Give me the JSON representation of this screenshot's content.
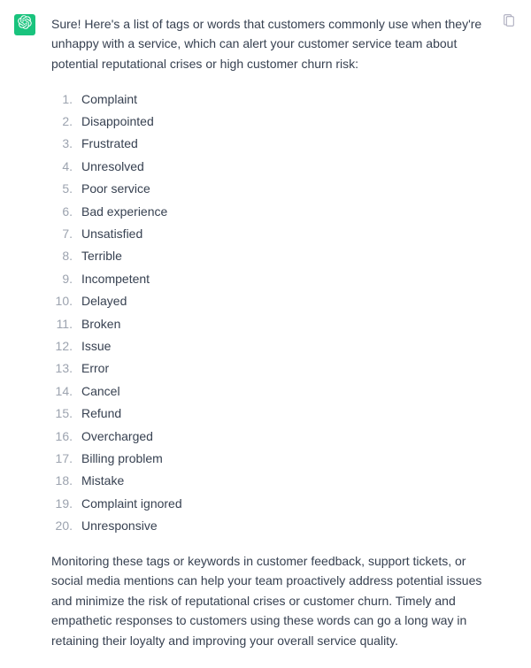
{
  "assistant": {
    "avatar_color": "#19c37d",
    "intro": "Sure! Here's a list of tags or words that customers commonly use when they're unhappy with a service, which can alert your customer service team about potential reputational crises or high customer churn risk:",
    "tags": [
      "Complaint",
      "Disappointed",
      "Frustrated",
      "Unresolved",
      "Poor service",
      "Bad experience",
      "Unsatisfied",
      "Terrible",
      "Incompetent",
      "Delayed",
      "Broken",
      "Issue",
      "Error",
      "Cancel",
      "Refund",
      "Overcharged",
      "Billing problem",
      "Mistake",
      "Complaint ignored",
      "Unresponsive"
    ],
    "outro": "Monitoring these tags or keywords in customer feedback, support tickets, or social media mentions can help your team proactively address potential issues and minimize the risk of reputational crises or customer churn. Timely and empathetic responses to customers using these words can go a long way in retaining their loyalty and improving your overall service quality."
  }
}
